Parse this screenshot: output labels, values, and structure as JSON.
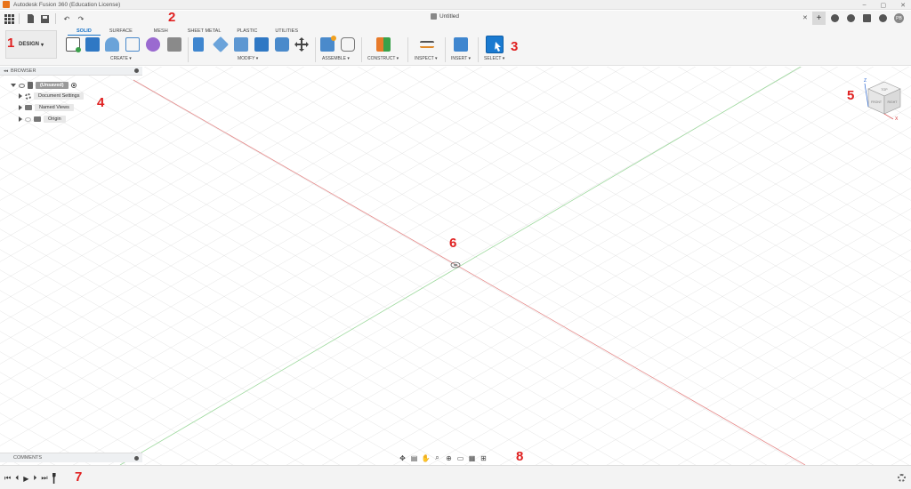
{
  "window": {
    "title": "Autodesk Fusion 360 (Education License)",
    "minimize": "–",
    "restore": "▢",
    "close": "✕"
  },
  "document": {
    "name": "Untitled",
    "tab_close": "✕",
    "new_tab": "+",
    "user_initials": "PB"
  },
  "workspace": {
    "label": "DESIGN",
    "caret": "▾"
  },
  "tabs": [
    {
      "label": "SOLID",
      "active": true
    },
    {
      "label": "SURFACE",
      "active": false
    },
    {
      "label": "MESH",
      "active": false
    },
    {
      "label": "SHEET METAL",
      "active": false
    },
    {
      "label": "PLASTIC",
      "active": false
    },
    {
      "label": "UTILITIES",
      "active": false
    }
  ],
  "groups": {
    "create": "CREATE ▾",
    "modify": "MODIFY ▾",
    "assemble": "ASSEMBLE ▾",
    "construct": "CONSTRUCT ▾",
    "inspect": "INSPECT ▾",
    "insert": "INSERT ▾",
    "select": "SELECT ▾"
  },
  "browser": {
    "title": "BROWSER",
    "root": "(Unsaved)",
    "items": [
      {
        "label": "Document Settings",
        "icon": "gear-icon"
      },
      {
        "label": "Named Views",
        "icon": "folder-icon"
      },
      {
        "label": "Origin",
        "icon": "folder-icon"
      }
    ]
  },
  "viewcube": {
    "top": "TOP",
    "front": "FRONT",
    "right": "RIGHT",
    "axis_x": "X",
    "axis_y": "Y",
    "axis_z": "Z"
  },
  "comments": {
    "title": "COMMENTS"
  },
  "timeline": {
    "first": "⏮",
    "prev": "⏴",
    "play": "▶",
    "next": "⏵",
    "last": "⏭"
  },
  "callouts": [
    "1",
    "2",
    "3",
    "4",
    "5",
    "6",
    "7",
    "8"
  ],
  "colors": {
    "accent": "#1a73c7",
    "axis_red": "#e07070",
    "axis_green": "#80d080",
    "callout": "#e02020"
  }
}
